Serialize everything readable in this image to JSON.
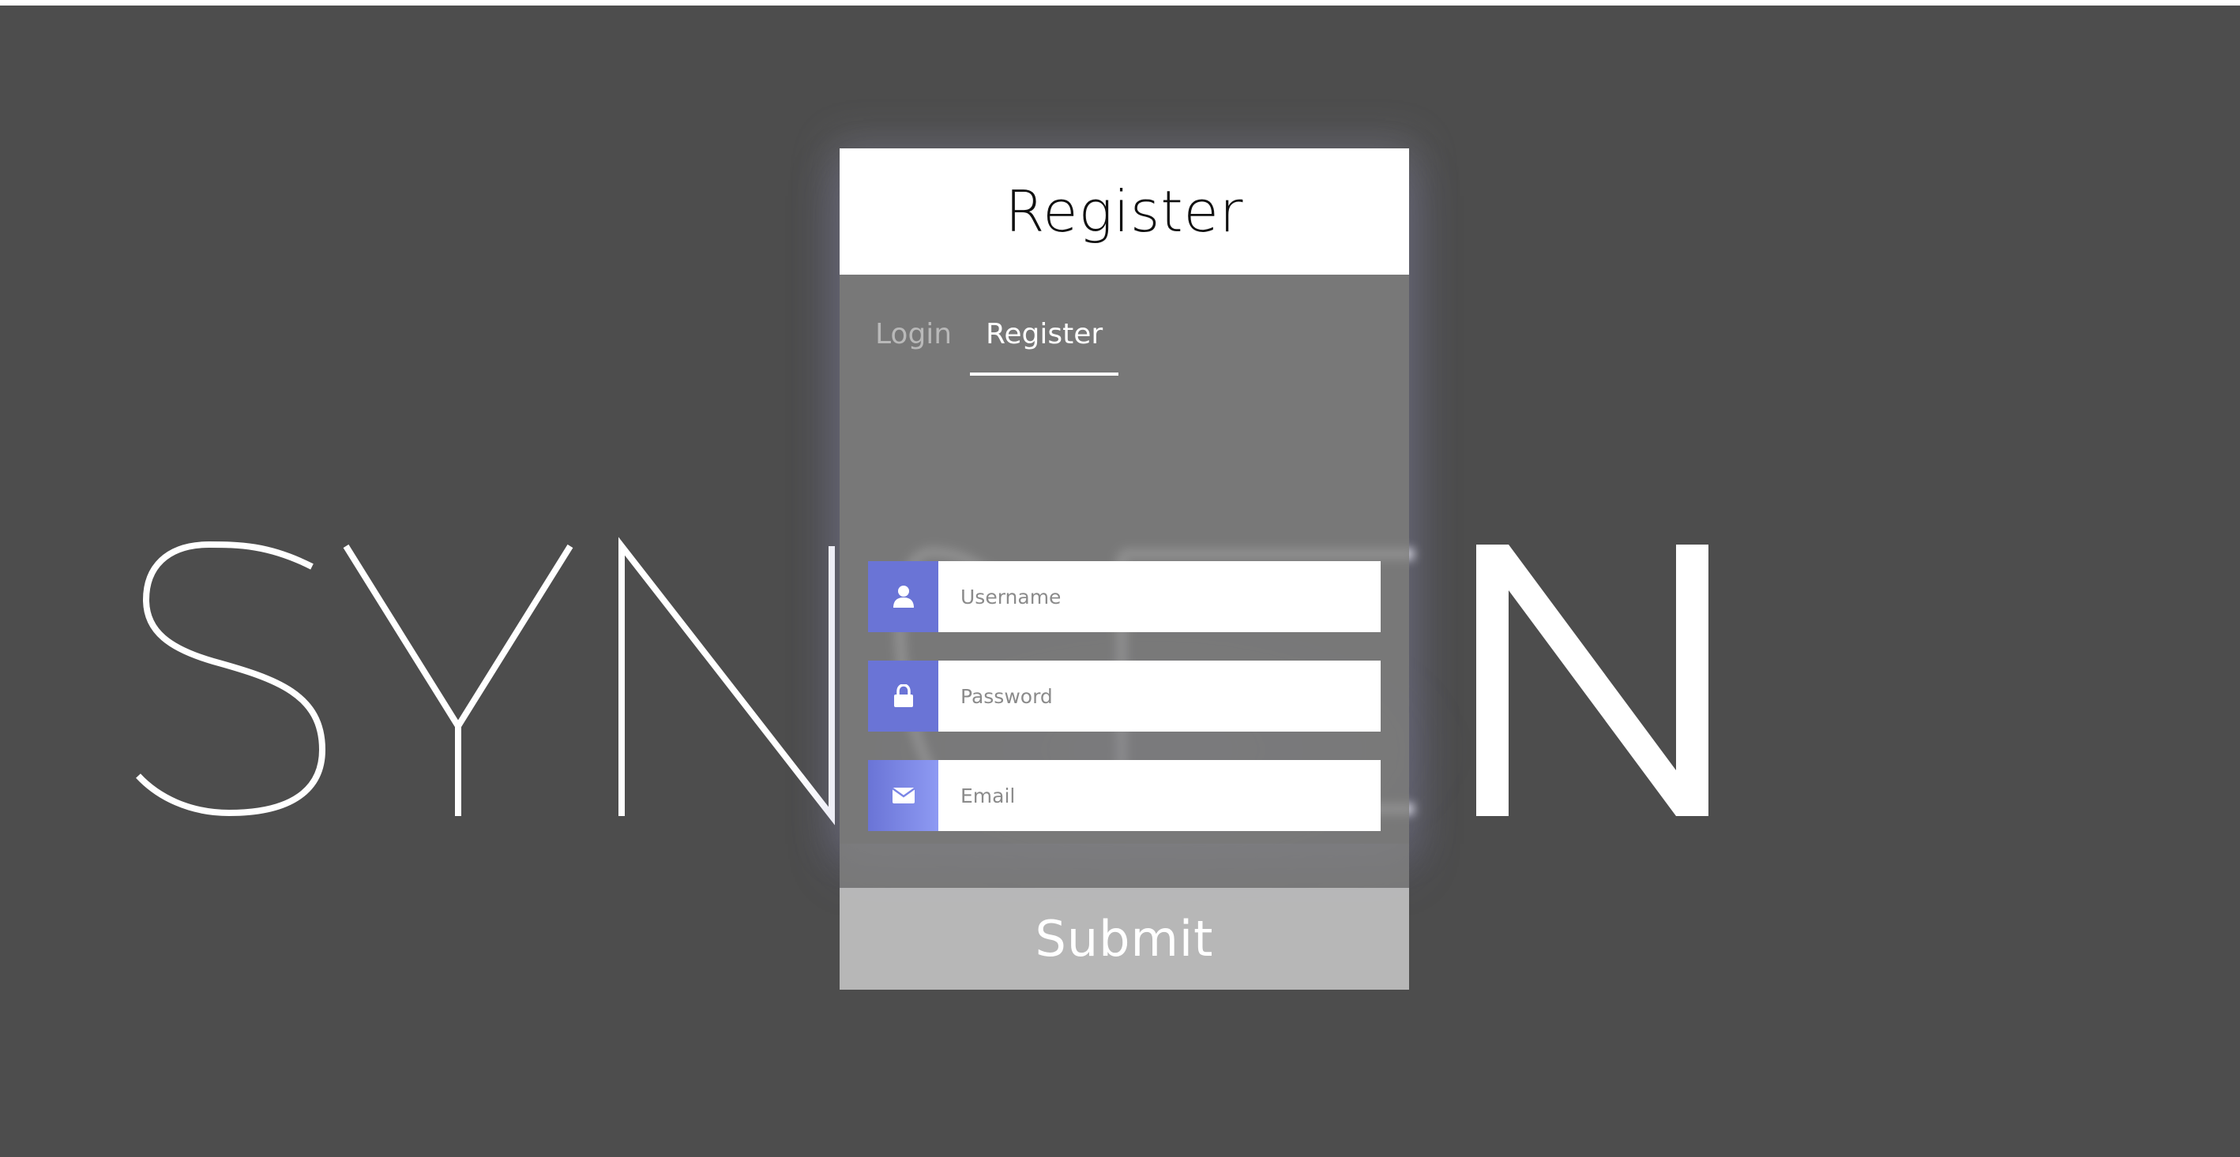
{
  "background": {
    "word": "SYNCEN",
    "color": "#4d4d4d"
  },
  "card": {
    "title": "Register",
    "tabs": [
      {
        "label": "Login",
        "active": false
      },
      {
        "label": "Register",
        "active": true
      }
    ],
    "fields": [
      {
        "placeholder": "Username",
        "icon": "user-icon",
        "value": ""
      },
      {
        "placeholder": "Password",
        "icon": "lock-icon",
        "value": ""
      },
      {
        "placeholder": "Email",
        "icon": "envelope-icon",
        "value": ""
      }
    ],
    "submit_label": "Submit",
    "accent_color": "#6a74d6"
  }
}
